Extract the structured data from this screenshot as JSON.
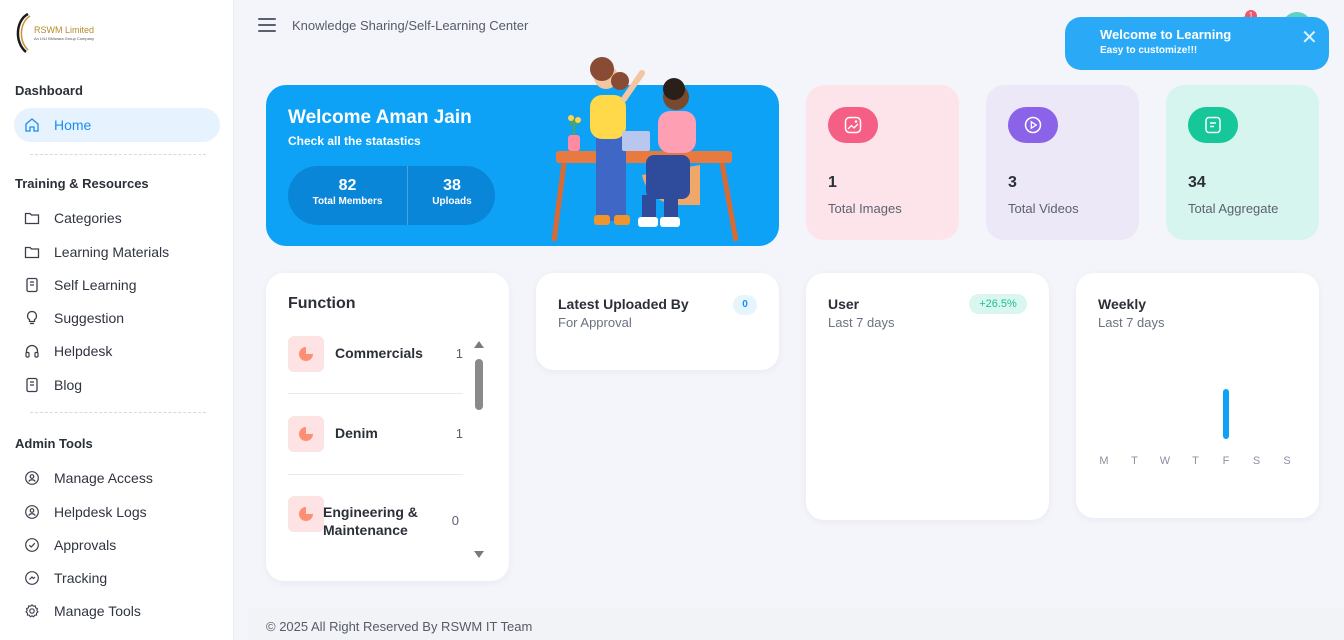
{
  "brand": {
    "name": "RSWM Limited",
    "tagline": "An LNJ Bhilwara Group Company"
  },
  "sidebar": {
    "sections": [
      {
        "title": "Dashboard",
        "items": [
          {
            "label": "Home",
            "icon": "home-icon",
            "active": true
          }
        ]
      },
      {
        "title": "Training & Resources",
        "items": [
          {
            "label": "Categories",
            "icon": "folder-icon"
          },
          {
            "label": "Learning Materials",
            "icon": "folder-icon"
          },
          {
            "label": "Self Learning",
            "icon": "notebook-icon"
          },
          {
            "label": "Suggestion",
            "icon": "lightbulb-icon"
          },
          {
            "label": "Helpdesk",
            "icon": "headset-icon"
          },
          {
            "label": "Blog",
            "icon": "notebook-icon"
          }
        ]
      },
      {
        "title": "Admin Tools",
        "items": [
          {
            "label": "Manage Access",
            "icon": "user-circle-icon"
          },
          {
            "label": "Helpdesk Logs",
            "icon": "user-circle-icon"
          },
          {
            "label": "Approvals",
            "icon": "check-circle-icon"
          },
          {
            "label": "Tracking",
            "icon": "tracking-icon"
          },
          {
            "label": "Manage Tools",
            "icon": "gear-icon"
          }
        ]
      }
    ]
  },
  "header": {
    "breadcrumb": "Knowledge Sharing/Self-Learning Center",
    "notification_count": "1"
  },
  "toast": {
    "title": "Welcome to Learning",
    "subtitle": "Easy to customize!!!",
    "close": "✕"
  },
  "welcome": {
    "title": "Welcome Aman Jain",
    "subtitle": "Check all the statastics",
    "stats": [
      {
        "value": "82",
        "label": "Total Members"
      },
      {
        "value": "38",
        "label": "Uploads"
      }
    ]
  },
  "tiles": [
    {
      "value": "1",
      "label": "Total Images",
      "icon": "image-icon",
      "bg": "#fde4ea",
      "accent": "#f55f86"
    },
    {
      "value": "3",
      "label": "Total Videos",
      "icon": "play-icon",
      "bg": "#ece8f8",
      "accent": "#8b63e9"
    },
    {
      "value": "34",
      "label": "Total Aggregate",
      "icon": "document-icon",
      "bg": "#d6f5ef",
      "accent": "#16c79a"
    }
  ],
  "function_card": {
    "title": "Function",
    "items": [
      {
        "name": "Commercials",
        "count": "1"
      },
      {
        "name": "Denim",
        "count": "1"
      },
      {
        "name": "Engineering & Maintenance",
        "count": "0"
      }
    ]
  },
  "latest_card": {
    "title": "Latest Uploaded By",
    "subtitle": "For Approval",
    "count": "0"
  },
  "user_card": {
    "title": "User",
    "subtitle": "Last 7 days",
    "change": "+26.5%"
  },
  "weekly_card": {
    "title": "Weekly",
    "subtitle": "Last 7 days",
    "chart_data": {
      "type": "bar",
      "categories": [
        "M",
        "T",
        "W",
        "T",
        "F",
        "S",
        "S"
      ],
      "values": [
        0,
        0,
        0,
        0,
        1,
        0,
        0
      ],
      "title": "",
      "xlabel": "",
      "ylabel": "",
      "bar_color": "#0ea2f6"
    }
  },
  "footer": {
    "text": "© 2025 All Right Reserved By RSWM IT Team"
  }
}
